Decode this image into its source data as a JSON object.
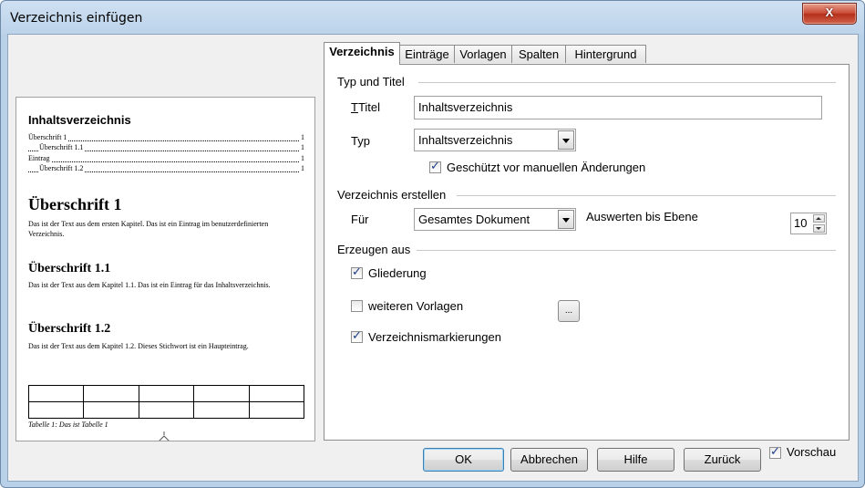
{
  "window": {
    "title": "Verzeichnis einfügen",
    "close_glyph": "X"
  },
  "tabs": [
    "Verzeichnis",
    "Einträge",
    "Vorlagen",
    "Spalten",
    "Hintergrund"
  ],
  "section_type": {
    "title": "Typ und Titel",
    "title_label": "Titel",
    "title_value": "Inhaltsverzeichnis",
    "type_label": "Typ",
    "type_value": "Inhaltsverzeichnis",
    "protect_label": "Geschützt vor manuellen Änderungen",
    "protect_checked": true
  },
  "section_create": {
    "title": "Verzeichnis erstellen",
    "for_label": "Für",
    "for_value": "Gesamtes Dokument",
    "levels_label": "Auswerten bis Ebene",
    "levels_value": "10"
  },
  "section_generate": {
    "title": "Erzeugen aus",
    "outline_label": "Gliederung",
    "outline_checked": true,
    "styles_label": "weiteren Vorlagen",
    "styles_checked": false,
    "styles_button": "...",
    "marks_label": "Verzeichnismarkierungen",
    "marks_checked": true
  },
  "preview": {
    "heading": "Inhaltsverzeichnis",
    "toc": [
      {
        "text": "Überschrift 1",
        "page": "1"
      },
      {
        "text": "Überschrift 1.1",
        "page": "1"
      },
      {
        "text": "Eintrag",
        "page": "1"
      },
      {
        "text": "Überschrift 1.2",
        "page": "1"
      }
    ],
    "h1": "Überschrift 1",
    "p1": "Das ist der Text aus dem ersten Kapitel. Das ist ein Eintrag im benutzerdefinierten Verzeichnis.",
    "h2a": "Überschrift 1.1",
    "p2": "Das ist der Text aus dem Kapitel 1.1. Das ist ein Eintrag für das Inhaltsverzeichnis.",
    "h2b": "Überschrift 1.2",
    "p3": "Das ist der Text aus dem Kapitel 1.2. Dieses Stichwort ist ein Haupteintrag.",
    "caption": "Tabelle 1: Das ist Tabelle 1"
  },
  "buttons": {
    "ok": "OK",
    "cancel": "Abbrechen",
    "help": "Hilfe",
    "back": "Zurück"
  },
  "preview_toggle": {
    "label": "Vorschau",
    "checked": true
  }
}
